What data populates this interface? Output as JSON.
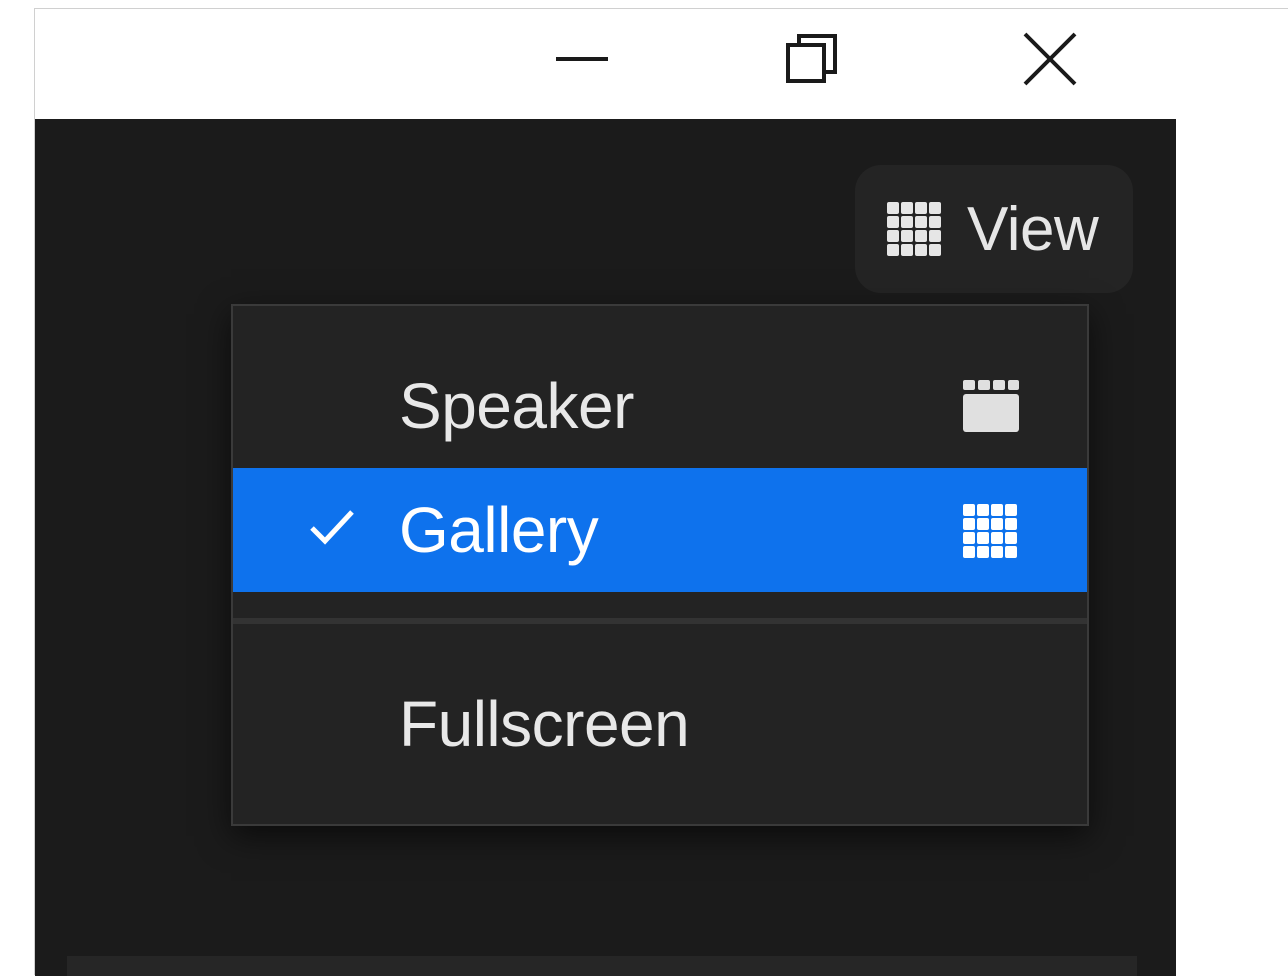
{
  "titlebar": {
    "minimize_icon": "minimize-icon",
    "restore_icon": "restore-icon",
    "close_icon": "close-icon"
  },
  "toolbar": {
    "view_label": "View",
    "view_icon": "gallery-grid-icon"
  },
  "view_menu": {
    "items": [
      {
        "label": "Speaker",
        "icon": "speaker-view-icon",
        "checked": false,
        "selected": false
      },
      {
        "label": "Gallery",
        "icon": "gallery-grid-icon",
        "checked": true,
        "selected": true
      },
      {
        "label": "Fullscreen",
        "checked": false,
        "selected": false
      }
    ],
    "highlight_color": "#0e72ed"
  },
  "colors": {
    "background": "#1b1b1b",
    "menu_background": "#232323",
    "text": "#e8e8e8"
  }
}
